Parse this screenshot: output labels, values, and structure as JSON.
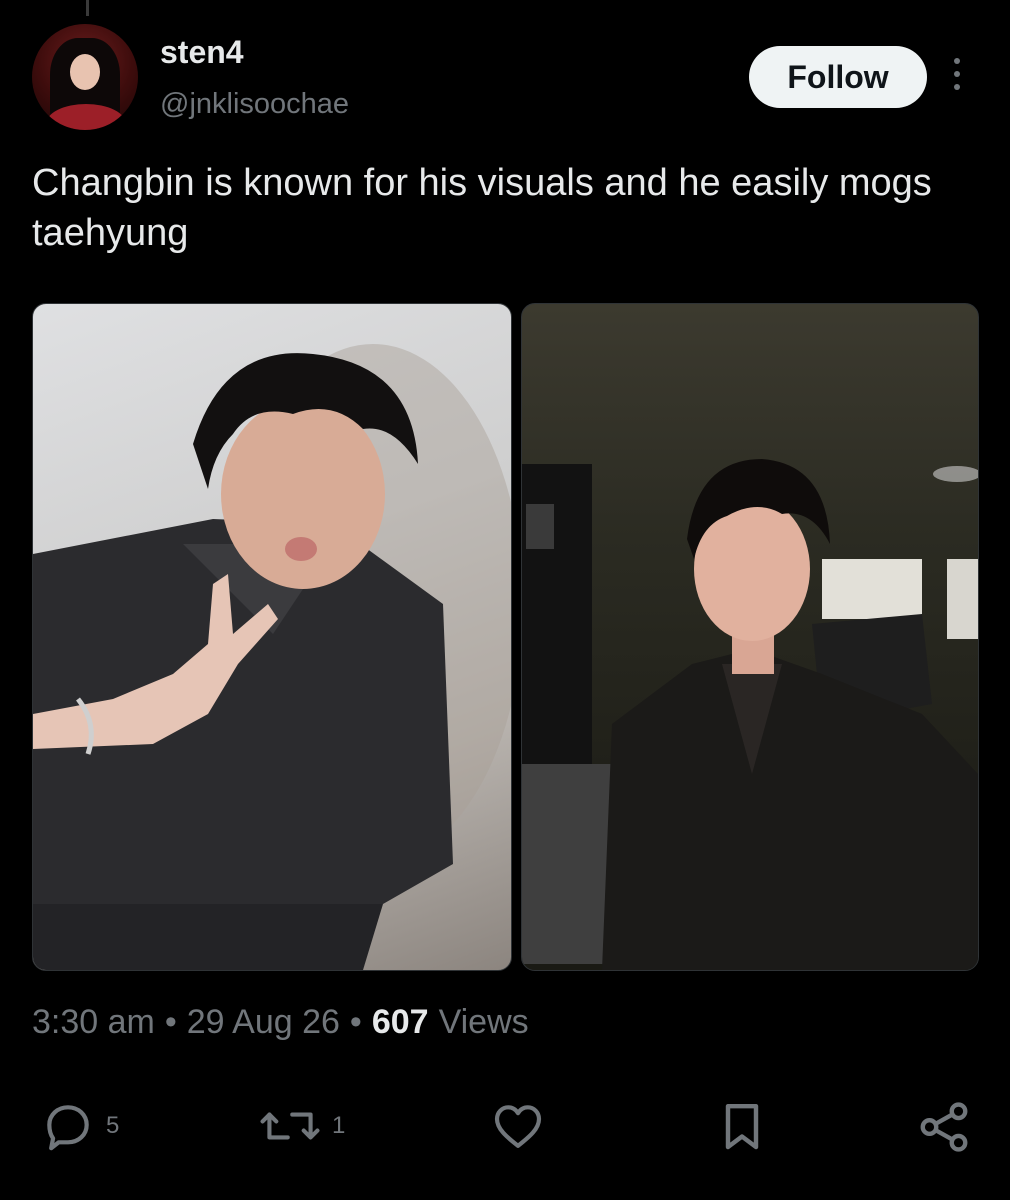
{
  "user": {
    "display_name": "sten4",
    "handle": "@jnklisoochae"
  },
  "follow_label": "Follow",
  "tweet": {
    "text": "Changbin is known for his visuals and he easily mogs taehyung"
  },
  "meta": {
    "time": "3:30 am",
    "separator": "•",
    "date": "29 Aug 26",
    "views_count": "607",
    "views_label": "Views"
  },
  "actions": {
    "replies": "5",
    "retweets": "1"
  },
  "icons": [
    "more-vertical-icon",
    "reply-icon",
    "retweet-icon",
    "like-icon",
    "bookmark-icon",
    "share-icon"
  ],
  "colors": {
    "background": "#000000",
    "text": "#e7e9ea",
    "muted": "#71767b",
    "follow_bg": "#eff3f4"
  }
}
